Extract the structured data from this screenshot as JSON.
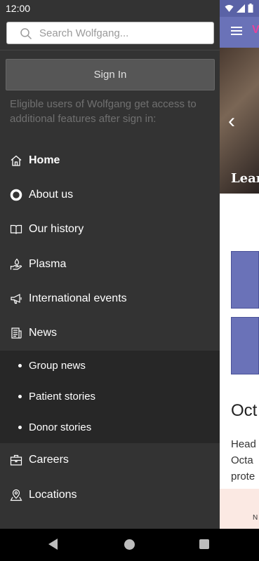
{
  "status_bar": {
    "time": "12:00"
  },
  "search": {
    "placeholder": "Search Wolfgang..."
  },
  "signin": {
    "button_label": "Sign In",
    "note": "Eligible users of Wolfgang get access to additional features after sign in:"
  },
  "menu": {
    "home": "Home",
    "about": "About us",
    "history": "Our history",
    "plasma": "Plasma",
    "events": "International events",
    "news": "News",
    "group_news": "Group news",
    "patient_stories": "Patient stories",
    "donor_stories": "Donor stories",
    "careers": "Careers",
    "locations": "Locations"
  },
  "background": {
    "hero_text": "Lear",
    "heading": "Oct",
    "para_line1": "Head",
    "para_line2": "Octa",
    "para_line3": "prote",
    "bottom_label": "N"
  },
  "colors": {
    "drawer": "#333333",
    "accent": "#6a72b8"
  }
}
